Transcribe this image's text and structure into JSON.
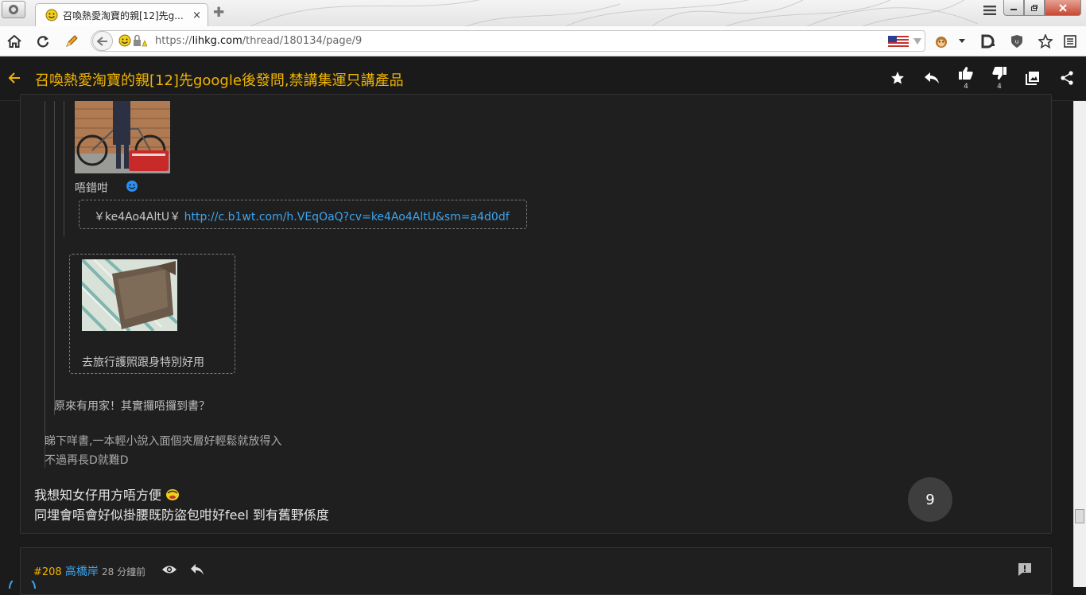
{
  "browser": {
    "tab_title": "召喚熱愛淘寶的親[12]先g...",
    "tab_close": "×",
    "url_prefix": "https://",
    "url_domain": "lihkg.com",
    "url_path": "/thread/180134/page/9"
  },
  "header": {
    "title": "召喚熱愛淘寶的親[12]先google後發問,禁講集運只講產品",
    "upvote_count": "4",
    "downvote_count": "4"
  },
  "post": {
    "quote_inner_caption": "唔錯咁",
    "taobao_code": "￥ke4Ao4AltU￥",
    "taobao_link": "http://c.b1wt.com/h.VEqOaQ?cv=ke4Ao4AltU&sm=a4d0df",
    "image2_caption": "去旅行護照跟身特別好用",
    "quote_level2_text": "原來有用家！其實攞唔攞到書？",
    "quote_level1_line1": "睇下咩書,一本輕小說入面個夾層好輕鬆就放得入",
    "quote_level1_line2": "不過再長D就難D",
    "body_line1": "我想知女仔用方唔方便",
    "body_line2": "同埋會唔會好似掛腰既防盜包咁好feel 到有舊野係度",
    "page_badge": "9"
  },
  "next_post": {
    "number": "#208",
    "username": "高橋岸",
    "time": "28 分鐘前"
  },
  "colors": {
    "accent": "#f0b400",
    "link": "#3ba5f0",
    "background": "#1b1b1b"
  }
}
